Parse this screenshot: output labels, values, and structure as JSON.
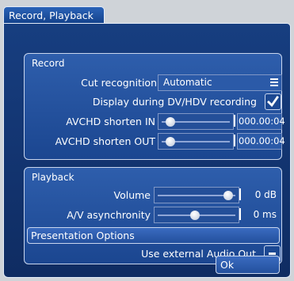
{
  "window": {
    "tab_title": "Record, Playback"
  },
  "record": {
    "title": "Record",
    "cut_recognition": {
      "label": "Cut recognition",
      "value": "Automatic",
      "icon": "list-icon"
    },
    "display_during": {
      "label": "Display during DV/HDV recording",
      "checked": true
    },
    "avchd_in": {
      "label": "AVCHD shorten IN",
      "value": "000.00:04",
      "position": 0.06
    },
    "avchd_out": {
      "label": "AVCHD shorten OUT",
      "value": "000.00:04",
      "position": 0.06
    }
  },
  "playback": {
    "title": "Playback",
    "volume": {
      "label": "Volume",
      "value": "0 dB",
      "position": 0.94
    },
    "av_async": {
      "label": "A/V asynchronity",
      "value": "0 ms",
      "position": 0.48
    },
    "presentation": {
      "label": "Presentation Options"
    },
    "external_audio": {
      "label": "Use external Audio Out",
      "checked": false
    }
  },
  "buttons": {
    "ok": "Ok"
  },
  "colors": {
    "background": "#0f2c62",
    "group": "#2e5eac",
    "accent": "#ffffff"
  }
}
